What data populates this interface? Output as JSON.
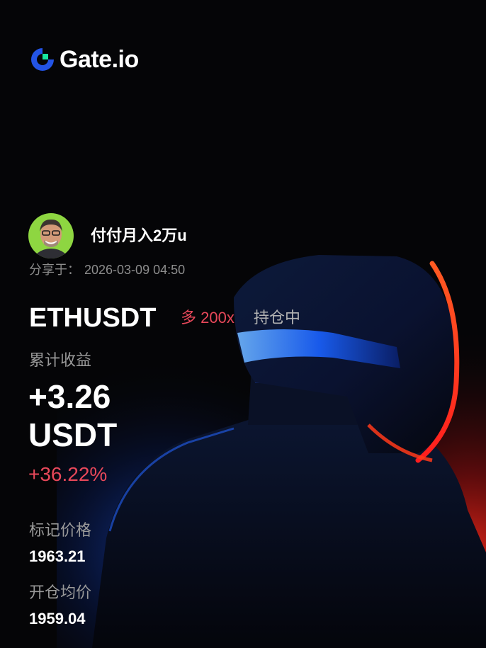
{
  "brand": {
    "name": "Gate.io"
  },
  "user": {
    "name": "付付月入2万u"
  },
  "share": {
    "label": "分享于：",
    "time": "2026-03-09 04:50"
  },
  "position": {
    "pair": "ETHUSDT",
    "side": "多 200x",
    "status": "持仓中"
  },
  "pnl": {
    "label": "累计收益",
    "value": "+3.26",
    "unit": "USDT",
    "percent": "+36.22%"
  },
  "mark_price": {
    "label": "标记价格",
    "value": "1963.21"
  },
  "entry_price": {
    "label": "开仓均价",
    "value": "1959.04"
  },
  "colors": {
    "background": "#050507",
    "profit": "#e8485a",
    "brand_blue": "#2354e6",
    "brand_green": "#17e6a1",
    "muted": "#9a9a9a"
  },
  "icons": {
    "logo": "gate-logo-icon",
    "avatar": "avatar"
  }
}
